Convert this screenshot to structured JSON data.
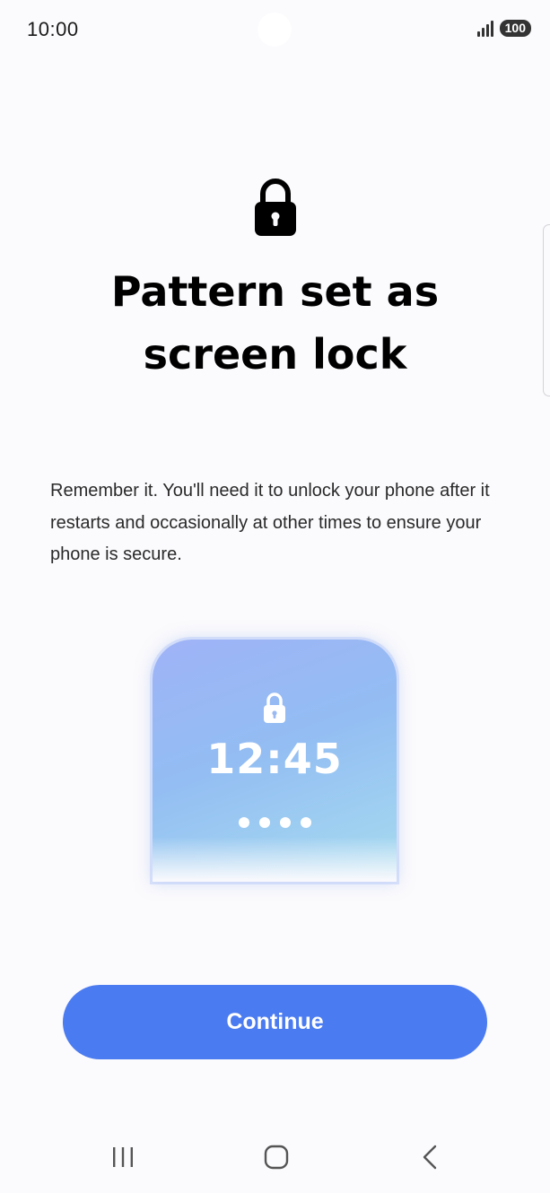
{
  "status_bar": {
    "time": "10:00",
    "battery": "100",
    "icons": [
      "signal-icon",
      "battery-icon"
    ]
  },
  "header": {
    "icon": "lock-icon",
    "title": "Pattern set as screen lock"
  },
  "body": {
    "description": "Remember it. You'll need it to unlock your phone after it restarts and occasionally at other times to ensure your phone is secure."
  },
  "illustration": {
    "icon": "lock-icon",
    "clock": "12:45",
    "pin_dot_count": 4
  },
  "actions": {
    "continue_label": "Continue"
  },
  "nav_bar": {
    "icons": [
      "recents-icon",
      "home-icon",
      "back-icon"
    ]
  },
  "colors": {
    "accent": "#4b7bf0",
    "background": "#fbfafd",
    "text": "#000000"
  }
}
